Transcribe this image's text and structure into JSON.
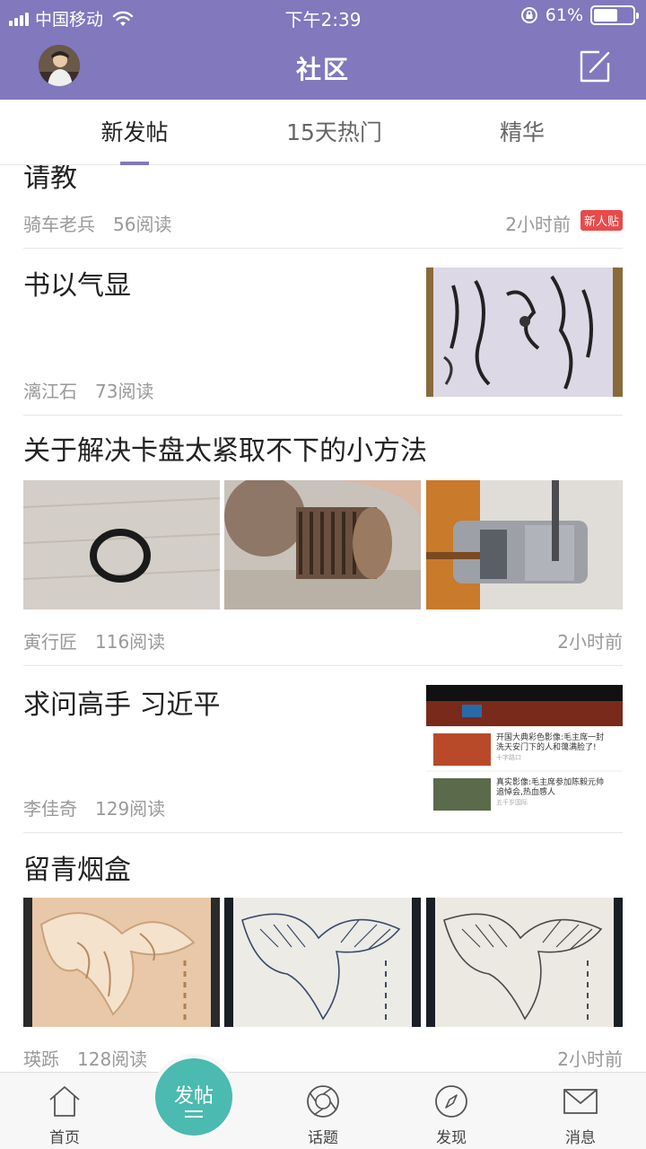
{
  "status_bar": {
    "carrier": "中国移动",
    "time": "下午2:39",
    "battery": "61%",
    "battery_level": 0.61
  },
  "header": {
    "title": "社区"
  },
  "tabs": [
    {
      "label": "新发帖",
      "active": true
    },
    {
      "label": "15天热门",
      "active": false
    },
    {
      "label": "精华",
      "active": false
    }
  ],
  "posts": [
    {
      "title": "请教",
      "author": "骑车老兵",
      "reads": "56阅读",
      "time": "2小时前",
      "badge": "新人贴"
    },
    {
      "title": "书以气显",
      "author": "漓江石",
      "reads": "73阅读",
      "time": ""
    },
    {
      "title": "关于解决卡盘太紧取不下的小方法",
      "author": "寅行匠",
      "reads": "116阅读",
      "time": "2小时前"
    },
    {
      "title": "求问高手  习近平",
      "author": "李佳奇",
      "reads": "129阅读",
      "time": "",
      "thumb_texts": [
        "开国大典彩色影像:毛主席一封",
        "洗天安门下的人和蔼满脸了!",
        "十字路口",
        "真实影像:毛主席参加陈毅元帅",
        "追悼会,热血感人",
        "五千岁国际"
      ]
    },
    {
      "title": "留青烟盒",
      "author": "瑛跞",
      "reads": "128阅读",
      "time": "2小时前"
    }
  ],
  "bottom_nav": {
    "home": "首页",
    "post": "发帖",
    "topics": "话题",
    "discover": "发现",
    "messages": "消息"
  },
  "colors": {
    "brand": "#8178bd",
    "fab": "#4bbab0",
    "badge": "#e84a4a"
  }
}
